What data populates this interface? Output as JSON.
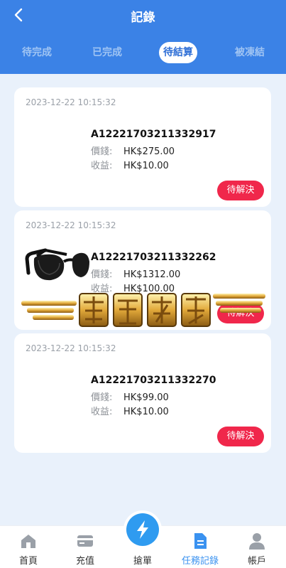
{
  "header": {
    "title": "記錄"
  },
  "tabs": [
    {
      "label": "待完成",
      "active": false
    },
    {
      "label": "已完成",
      "active": false
    },
    {
      "label": "待結算",
      "active": true
    },
    {
      "label": "被凍結",
      "active": false
    }
  ],
  "orders": [
    {
      "time": "2023-12-22 10:15:32",
      "id": "A12221703211332917",
      "price_label": "價錢:",
      "price": "HK$275.00",
      "earn_label": "收益:",
      "earn": "HK$10.00",
      "status": "待解決",
      "image": "none"
    },
    {
      "time": "2023-12-22 10:15:32",
      "id": "A12221703211332262",
      "price_label": "價錢:",
      "price": "HK$1312.00",
      "earn_label": "收益:",
      "earn": "HK$100.00",
      "status": "待解決",
      "image": "sunglasses"
    },
    {
      "time": "2023-12-22 10:15:32",
      "id": "A12221703211332270",
      "price_label": "價錢:",
      "price": "HK$99.00",
      "earn_label": "收益:",
      "earn": "HK$10.00",
      "status": "待解決",
      "image": "none"
    }
  ],
  "watermark": {
    "text": "南亚科技"
  },
  "nav": [
    {
      "label": "首頁",
      "icon": "home-icon",
      "active": false
    },
    {
      "label": "充值",
      "icon": "card-icon",
      "active": false
    },
    {
      "label": "搶單",
      "icon": "lightning-icon",
      "active": false
    },
    {
      "label": "任務記錄",
      "icon": "document-icon",
      "active": true
    },
    {
      "label": "帳戶",
      "icon": "user-icon",
      "active": false
    }
  ],
  "colors": {
    "header": "#3b82e6",
    "accent": "#3a92f0",
    "pill": "#f0274b",
    "background": "#e9f1fb"
  }
}
